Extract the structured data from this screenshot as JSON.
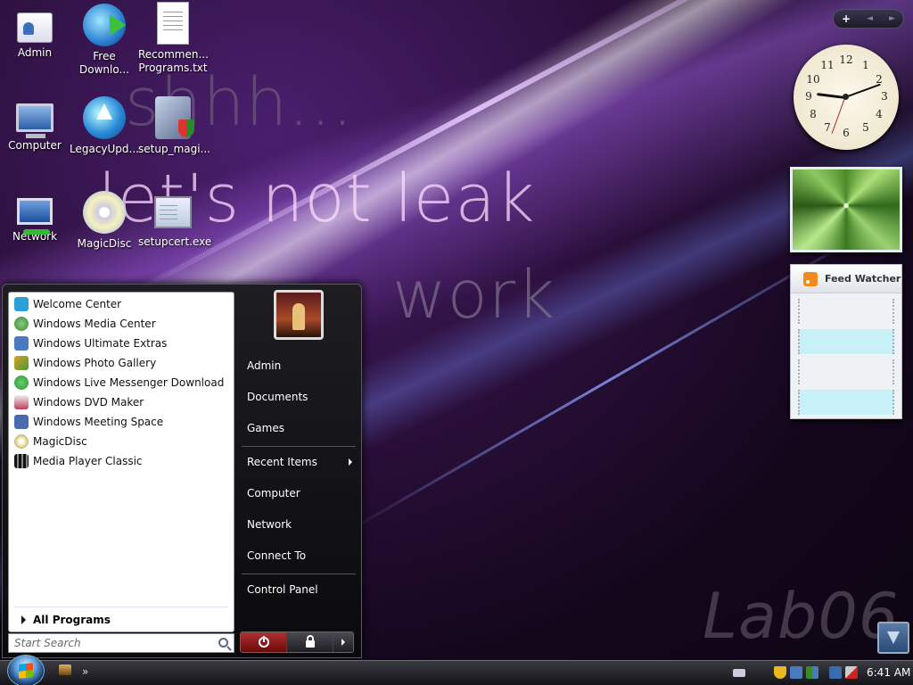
{
  "wallpaper": {
    "line1": "shhh...",
    "line2": "let's not leak",
    "line3": "work",
    "watermark": "Lab06"
  },
  "desktop_icons": [
    {
      "label": "Admin",
      "icon": "user-folder-icon"
    },
    {
      "label": "Free\nDownlo...",
      "icon": "download-globe-icon"
    },
    {
      "label": "Recommen...\nPrograms.txt",
      "icon": "text-file-icon"
    },
    {
      "label": "Computer",
      "icon": "computer-icon"
    },
    {
      "label": "LegacyUpd...",
      "icon": "update-globe-icon"
    },
    {
      "label": "setup_magi...",
      "icon": "installer-icon"
    },
    {
      "label": "Network",
      "icon": "network-icon"
    },
    {
      "label": "MagicDisc",
      "icon": "disc-icon"
    },
    {
      "label": "setupcert.exe",
      "icon": "certificate-icon"
    }
  ],
  "sidebar": {
    "add_label": "+",
    "prev_label": "◄",
    "next_label": "►",
    "clock_numbers": [
      "12",
      "1",
      "2",
      "3",
      "4",
      "5",
      "6",
      "7",
      "8",
      "9",
      "10",
      "11"
    ],
    "feed_title": "Feed Watcher"
  },
  "start_menu": {
    "programs": [
      {
        "label": "Welcome Center",
        "color": "#2aa0d8"
      },
      {
        "label": "Windows Media Center",
        "color": "#3a8a2a"
      },
      {
        "label": "Windows Ultimate Extras",
        "color": "#4a7ac0"
      },
      {
        "label": "Windows Photo Gallery",
        "color": "#d8a020"
      },
      {
        "label": "Windows Live Messenger Download",
        "color": "#2a9a3a"
      },
      {
        "label": "Windows DVD Maker",
        "color": "#c04060"
      },
      {
        "label": "Windows Meeting Space",
        "color": "#4a6ab0"
      },
      {
        "label": "MagicDisc",
        "color": "#e8d880"
      },
      {
        "label": "Media Player Classic",
        "color": "#303030"
      }
    ],
    "all_programs": "All Programs",
    "search_placeholder": "Start Search",
    "right_items": {
      "admin": "Admin",
      "documents": "Documents",
      "games": "Games",
      "recent_items": "Recent Items",
      "computer": "Computer",
      "network": "Network",
      "connect_to": "Connect To",
      "control_panel": "Control Panel"
    }
  },
  "taskbar": {
    "quicklaunch_more": "»",
    "time": "6:41 AM"
  }
}
